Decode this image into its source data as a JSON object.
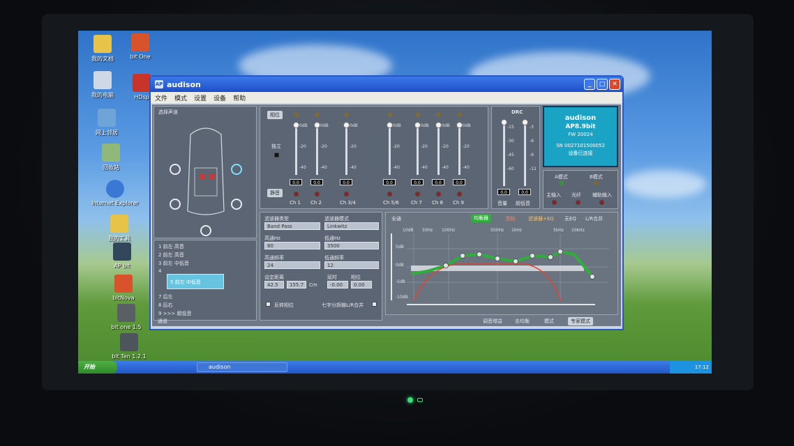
{
  "desktop_icons": [
    {
      "label": "我的文档",
      "icon": "folder-icon"
    },
    {
      "label": "我的电脑",
      "icon": "computer-icon"
    },
    {
      "label": "网上邻居",
      "icon": "network-icon"
    },
    {
      "label": "回收站",
      "icon": "recycle-bin-icon"
    },
    {
      "label": "Internet Explorer",
      "icon": "ie-icon"
    },
    {
      "label": "我的工具",
      "icon": "folder-icon"
    },
    {
      "label": "AP bit",
      "icon": "ap-bit-icon"
    },
    {
      "label": "bitNova",
      "icon": "bitnova-icon"
    },
    {
      "label": "bit one 1.5",
      "icon": "bit-one-icon"
    },
    {
      "label": "bit Ten 1.2.1",
      "icon": "bit-ten-icon"
    },
    {
      "label": "bit One",
      "icon": "bit-one-icon"
    },
    {
      "label": "HDsp",
      "icon": "hdsp-icon"
    }
  ],
  "window": {
    "title": "audison",
    "menu": [
      "文件",
      "模式",
      "设置",
      "设备",
      "帮助"
    ]
  },
  "left_panel": {
    "title": "选择声道",
    "channel_list": [
      "1  前左 高音",
      "2  前左 高音",
      "3  前左 中低音",
      "4",
      "5  前左 中低音",
      "6",
      "7  后左",
      "8  后右",
      "9 >>> 超低音"
    ],
    "footer": "通道"
  },
  "mixer": {
    "link_label": "相位",
    "mute_label": "静音",
    "solo_label": "独立",
    "channels": [
      {
        "name": "Ch 1",
        "value": "0.0",
        "level": 1.0
      },
      {
        "name": "Ch 2",
        "value": "0.0",
        "level": 1.0
      },
      {
        "name": "Ch 3/4",
        "value": "0.0",
        "level": 1.0
      },
      {
        "name": "Ch 5/6",
        "value": "0.0",
        "level": 1.0
      },
      {
        "name": "Ch 7",
        "value": "0.0",
        "level": 1.0
      },
      {
        "name": "Ch 8",
        "value": "0.0",
        "level": 1.0
      },
      {
        "name": "Ch 9",
        "value": "0.0",
        "level": 1.0
      }
    ],
    "scale": [
      "0dB",
      "-20",
      "-40"
    ]
  },
  "drc": {
    "title": "DRC",
    "scale_left": [
      "0",
      "-15",
      "-30",
      "-45",
      "-60"
    ],
    "scale_right": [
      "0",
      "-3",
      "-6",
      "-9",
      "-12"
    ],
    "values": [
      "0.0",
      "0.0"
    ],
    "labels": [
      "音量",
      "超低音"
    ]
  },
  "brand_box": {
    "brand": "audison",
    "model": "AP8.9bit",
    "fw": "FW 20024",
    "sn": "SN 0027101500052",
    "status": "设备已连接"
  },
  "mode_box": {
    "a_mode": "A模式",
    "b_mode": "B模式",
    "inputs": [
      "主输入",
      "光纤",
      "辅助输入"
    ]
  },
  "filter": {
    "type_label": "滤波器类型",
    "type_value": "Band Pass",
    "mode_label": "滤波器模式",
    "mode_value": "Linkwitz",
    "hp_freq_label": "高通Hz",
    "hp_freq_value": "80",
    "lp_freq_label": "低通Hz",
    "lp_freq_value": "3500",
    "hp_slope_label": "高通斜率",
    "hp_slope_value": "24",
    "lp_slope_label": "低通斜率",
    "lp_slope_value": "12",
    "delay_label": "设定距离",
    "delay_values": [
      "42.5",
      "155.7",
      "Cm"
    ],
    "level_label": "延时",
    "phase_label": "相位",
    "level_values": [
      "-0.00",
      "0.00"
    ],
    "checkbox1": "反转相位",
    "checkbox2": "七字分拆输L/R合并"
  },
  "eq": {
    "title": "全通",
    "freq_labels": [
      "10dB",
      "50Hz",
      "100Hz",
      "500Hz",
      "1kHz",
      "5kHz",
      "10kHz"
    ],
    "db_labels": [
      "5dB",
      "0dB",
      "-5dB",
      "-10dB"
    ],
    "tag": "均衡器",
    "legend": [
      "图标",
      "滤波器+EQ",
      "无EQ",
      "L/R合并"
    ],
    "bottom": [
      "调音增益",
      "去均衡",
      "模式",
      "专家模式"
    ]
  },
  "taskbar": {
    "start": "开始",
    "item": "audison",
    "clock": "17:12"
  },
  "colors": {
    "eq_green": "#2fae3c",
    "eq_red": "#e2432c",
    "brand_bg": "#1aa3c4"
  }
}
